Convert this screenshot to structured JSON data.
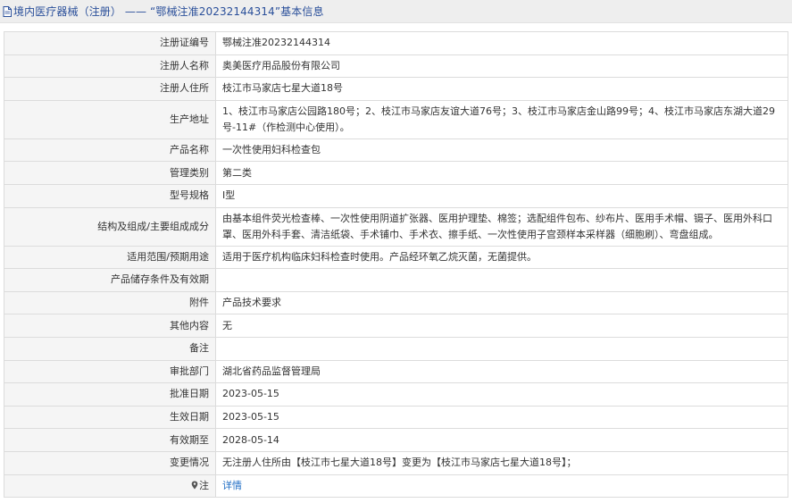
{
  "header": {
    "title": "境内医疗器械（注册） —— “鄂械注准20232144314”基本信息",
    "icon": "document-icon"
  },
  "rows": [
    {
      "label": "注册证编号",
      "value": "鄂械注准20232144314"
    },
    {
      "label": "注册人名称",
      "value": "奥美医疗用品股份有限公司"
    },
    {
      "label": "注册人住所",
      "value": "枝江市马家店七星大道18号"
    },
    {
      "label": "生产地址",
      "value": "1、枝江市马家店公园路180号；2、枝江市马家店友谊大道76号；3、枝江市马家店金山路99号；4、枝江市马家店东湖大道29号-11#（作检测中心使用）。"
    },
    {
      "label": "产品名称",
      "value": "一次性使用妇科检查包"
    },
    {
      "label": "管理类别",
      "value": "第二类"
    },
    {
      "label": "型号规格",
      "value": "Ⅰ型"
    },
    {
      "label": "结构及组成/主要组成成分",
      "value": "由基本组件荧光检查棒、一次性使用阴道扩张器、医用护理垫、棉签；选配组件包布、纱布片、医用手术帽、镊子、医用外科口罩、医用外科手套、清洁纸袋、手术铺巾、手术衣、擦手纸、一次性使用子宫颈样本采样器（细胞刷）、弯盘组成。"
    },
    {
      "label": "适用范围/预期用途",
      "value": "适用于医疗机构临床妇科检查时使用。产品经环氧乙烷灭菌，无菌提供。"
    },
    {
      "label": "产品储存条件及有效期",
      "value": ""
    },
    {
      "label": "附件",
      "value": "产品技术要求"
    },
    {
      "label": "其他内容",
      "value": "无"
    },
    {
      "label": "备注",
      "value": ""
    },
    {
      "label": "审批部门",
      "value": "湖北省药品监督管理局"
    },
    {
      "label": "批准日期",
      "value": "2023-05-15"
    },
    {
      "label": "生效日期",
      "value": "2023-05-15"
    },
    {
      "label": "有效期至",
      "value": "2028-05-14"
    },
    {
      "label": "变更情况",
      "value": "无注册人住所由【枝江市七星大道18号】变更为【枝江市马家店七星大道18号】；"
    }
  ],
  "footer_row": {
    "label": "注",
    "icon": "pin-icon",
    "link_text": "详情",
    "link_color": "#1f6dc4"
  }
}
